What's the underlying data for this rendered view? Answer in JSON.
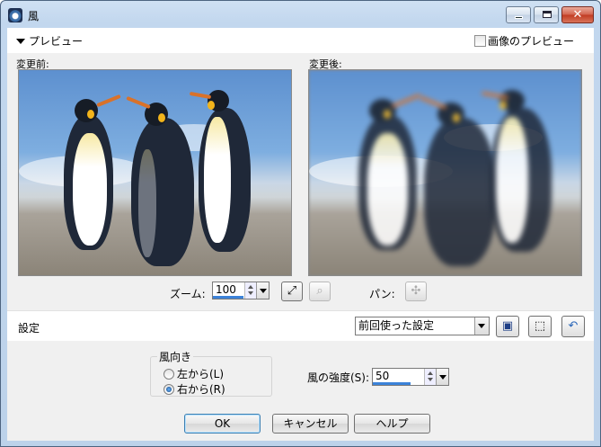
{
  "window": {
    "title": "風"
  },
  "preview": {
    "toggle_label": "プレビュー",
    "image_preview_label": "画像のプレビュー",
    "before_label": "変更前:",
    "after_label": "変更後:"
  },
  "zoom": {
    "label": "ズーム:",
    "value": "100",
    "pan_label": "パン:"
  },
  "settings": {
    "label": "設定",
    "preset_value": "前回使った設定"
  },
  "direction": {
    "group_label": "風向き",
    "left_label": "左から(L)",
    "right_label": "右から(R)",
    "selected": "right"
  },
  "strength": {
    "label": "風の強度(S):",
    "value": "50"
  },
  "buttons": {
    "ok": "OK",
    "cancel": "キャンセル",
    "help": "ヘルプ"
  },
  "icons": {
    "window": "app-icon",
    "save": "save-icon",
    "preset_manage": "box-icon",
    "reset": "reset-arrow-icon",
    "zoom_fit": "fit-icon",
    "zoom_reset": "magnifier-icon",
    "pan": "move-icon"
  }
}
